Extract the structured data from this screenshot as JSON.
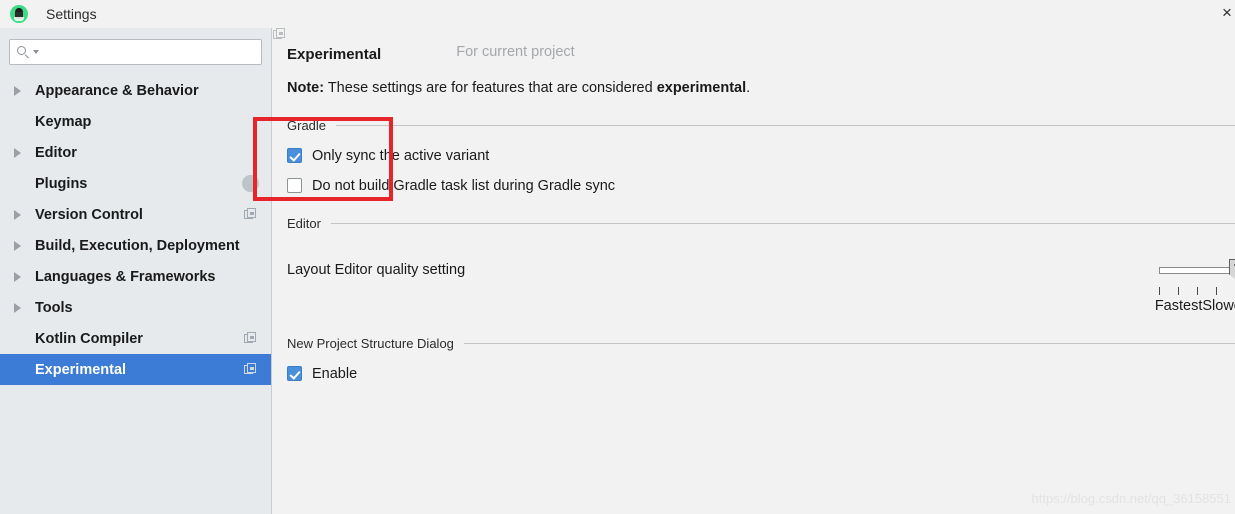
{
  "window": {
    "title": "Settings",
    "app_icon": "android-studio-icon",
    "close_label": "×"
  },
  "sidebar": {
    "search": {
      "value": "",
      "placeholder": "",
      "icon": "search-icon"
    },
    "items": [
      {
        "label": "Appearance & Behavior",
        "expandable": true,
        "selected": false,
        "badge": "none"
      },
      {
        "label": "Keymap",
        "expandable": false,
        "selected": false,
        "badge": "none"
      },
      {
        "label": "Editor",
        "expandable": true,
        "selected": false,
        "badge": "none"
      },
      {
        "label": "Plugins",
        "expandable": false,
        "selected": false,
        "badge": "circle"
      },
      {
        "label": "Version Control",
        "expandable": true,
        "selected": false,
        "badge": "copy"
      },
      {
        "label": "Build, Execution, Deployment",
        "expandable": true,
        "selected": false,
        "badge": "none"
      },
      {
        "label": "Languages & Frameworks",
        "expandable": true,
        "selected": false,
        "badge": "none"
      },
      {
        "label": "Tools",
        "expandable": true,
        "selected": false,
        "badge": "none"
      },
      {
        "label": "Kotlin Compiler",
        "expandable": false,
        "selected": false,
        "badge": "copy"
      },
      {
        "label": "Experimental",
        "expandable": false,
        "selected": true,
        "badge": "copy"
      }
    ]
  },
  "main": {
    "page_title": "Experimental",
    "scope_tag": "For current project",
    "note": {
      "prefix": "Note:",
      "text": " These settings are for features that are considered ",
      "emphasis": "experimental",
      "suffix": "."
    },
    "sections": [
      {
        "name": "gradle",
        "label": "Gradle",
        "checkboxes": [
          {
            "label": "Only sync the active variant",
            "checked": true
          },
          {
            "label": "Do not build Gradle task list during Gradle sync",
            "checked": false
          }
        ]
      },
      {
        "name": "editor",
        "label": "Editor",
        "setting_label": "Layout Editor quality setting",
        "slider": {
          "min_label": "Fastest",
          "max_label": "Slowest",
          "ticks": 5,
          "value_position": "max"
        }
      },
      {
        "name": "new-project-structure-dialog",
        "label": "New Project Structure Dialog",
        "checkboxes": [
          {
            "label": "Enable",
            "checked": true
          }
        ]
      }
    ]
  },
  "annotation": {
    "highlight_color": "#e8242b",
    "watermark": "https://blog.csdn.net/qq_36158551"
  }
}
